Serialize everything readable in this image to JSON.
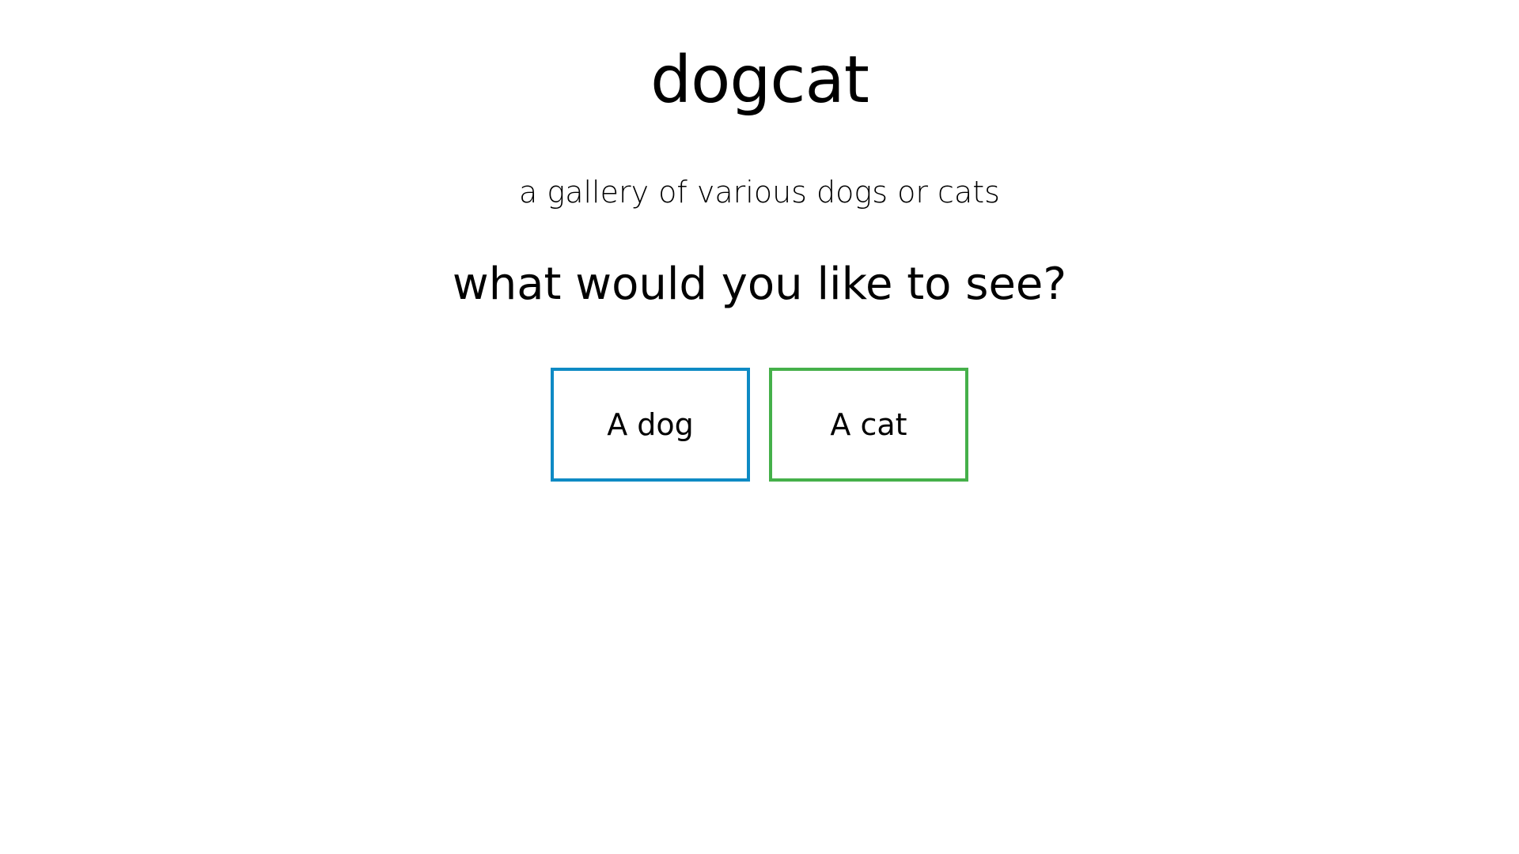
{
  "header": {
    "title": "dogcat",
    "subtitle": "a gallery of various dogs or cats"
  },
  "main": {
    "prompt": "what would you like to see?",
    "choices": [
      {
        "label": "A dog",
        "border_color": "#0e8ac4"
      },
      {
        "label": "A cat",
        "border_color": "#45b04a"
      }
    ]
  }
}
